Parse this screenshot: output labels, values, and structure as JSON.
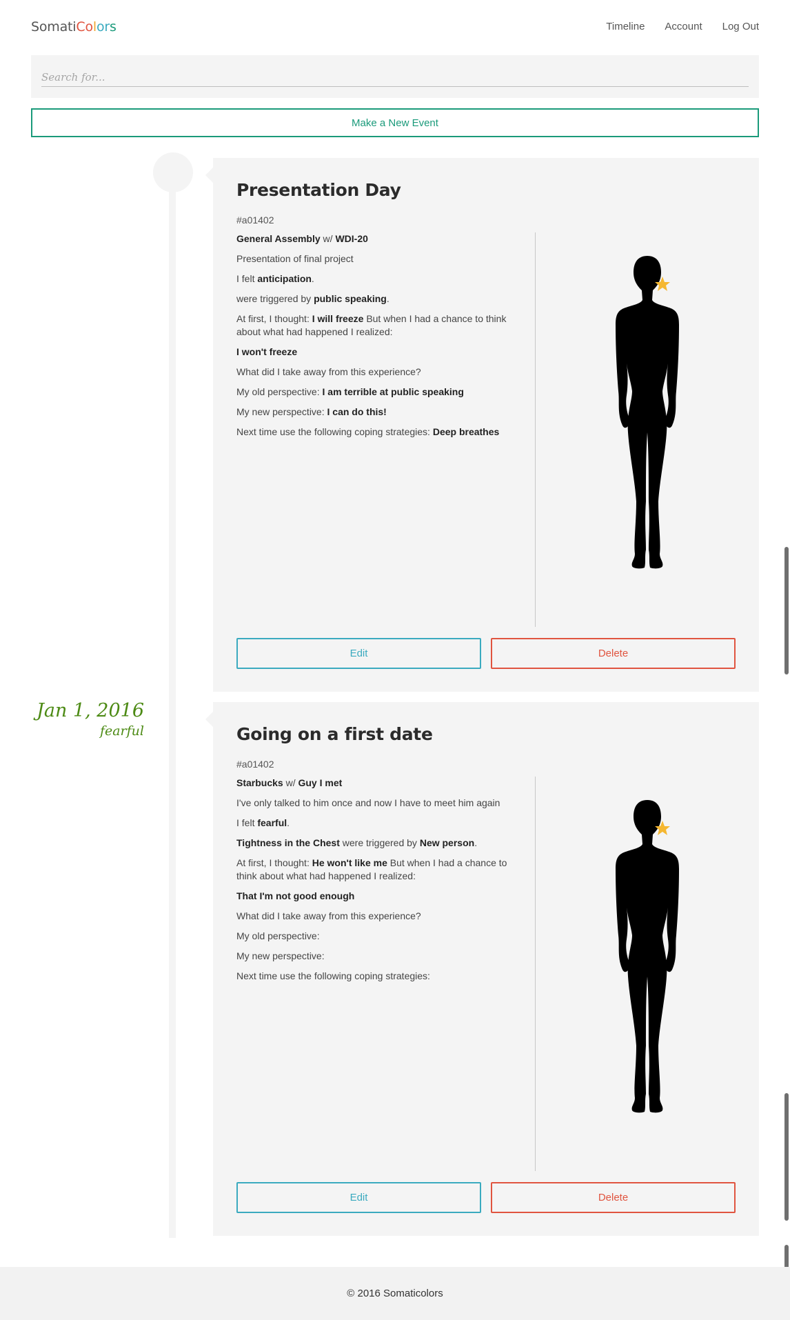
{
  "brand": {
    "parts": [
      {
        "text": "Somati",
        "color": "#555555"
      },
      {
        "text": "C",
        "color": "#e0543f"
      },
      {
        "text": "o",
        "color": "#e0543f"
      },
      {
        "text": "l",
        "color": "#f0a830"
      },
      {
        "text": "o",
        "color": "#3aaabf"
      },
      {
        "text": "r",
        "color": "#3aaabf"
      },
      {
        "text": "s",
        "color": "#1a9a7a"
      }
    ]
  },
  "nav": {
    "items": [
      "Timeline",
      "Account",
      "Log Out"
    ]
  },
  "search": {
    "placeholder": "Search for...",
    "value": ""
  },
  "new_event": {
    "label": "Make a New Event"
  },
  "colors": {
    "accent_green": "#1a9a7a",
    "edit_blue": "#3aaabf",
    "delete_red": "#e0543f",
    "date_green": "#4c8a14",
    "star_yellow": "#f5b731"
  },
  "date_marker": {
    "date": "Jan 1, 2016",
    "emotion": "fearful"
  },
  "events": [
    {
      "title": "Presentation Day",
      "code": "#a01402",
      "location": "General Assembly",
      "with_word": "w/",
      "with": "WDI-20",
      "description": "Presentation of final project",
      "felt_prefix": "I felt",
      "felt": "anticipation",
      "trigger_subject": "",
      "trigger_prefix": "were triggered by",
      "trigger": "public speaking",
      "thought_prefix": "At first, I thought:",
      "thought": "I will freeze",
      "thought_suffix": "But when I had a chance to think about what had happened I realized:",
      "realized": "I won't freeze",
      "takeaway_q": "What did I take away from this experience?",
      "old_prefix": "My old perspective:",
      "old": "I am terrible at public speaking",
      "new_prefix": "My new perspective:",
      "new": "I can do this!",
      "coping_prefix": "Next time use the following coping strategies:",
      "coping": "Deep breathes",
      "edit_label": "Edit",
      "delete_label": "Delete"
    },
    {
      "title": "Going on a first date",
      "code": "#a01402",
      "location": "Starbucks",
      "with_word": "w/",
      "with": "Guy I met",
      "description": "I've only talked to him once and now I have to meet him again",
      "felt_prefix": "I felt",
      "felt": "fearful",
      "trigger_subject": "Tightness in the Chest",
      "trigger_prefix": "were triggered by",
      "trigger": "New person",
      "thought_prefix": "At first, I thought:",
      "thought": "He won't like me",
      "thought_suffix": "But when I had a chance to think about what had happened I realized:",
      "realized": "That I'm not good enough",
      "takeaway_q": "What did I take away from this experience?",
      "old_prefix": "My old perspective:",
      "old": "",
      "new_prefix": "My new perspective:",
      "new": "",
      "coping_prefix": "Next time use the following coping strategies:",
      "coping": "",
      "edit_label": "Edit",
      "delete_label": "Delete"
    }
  ],
  "footer": {
    "text": "© 2016 Somaticolors"
  }
}
